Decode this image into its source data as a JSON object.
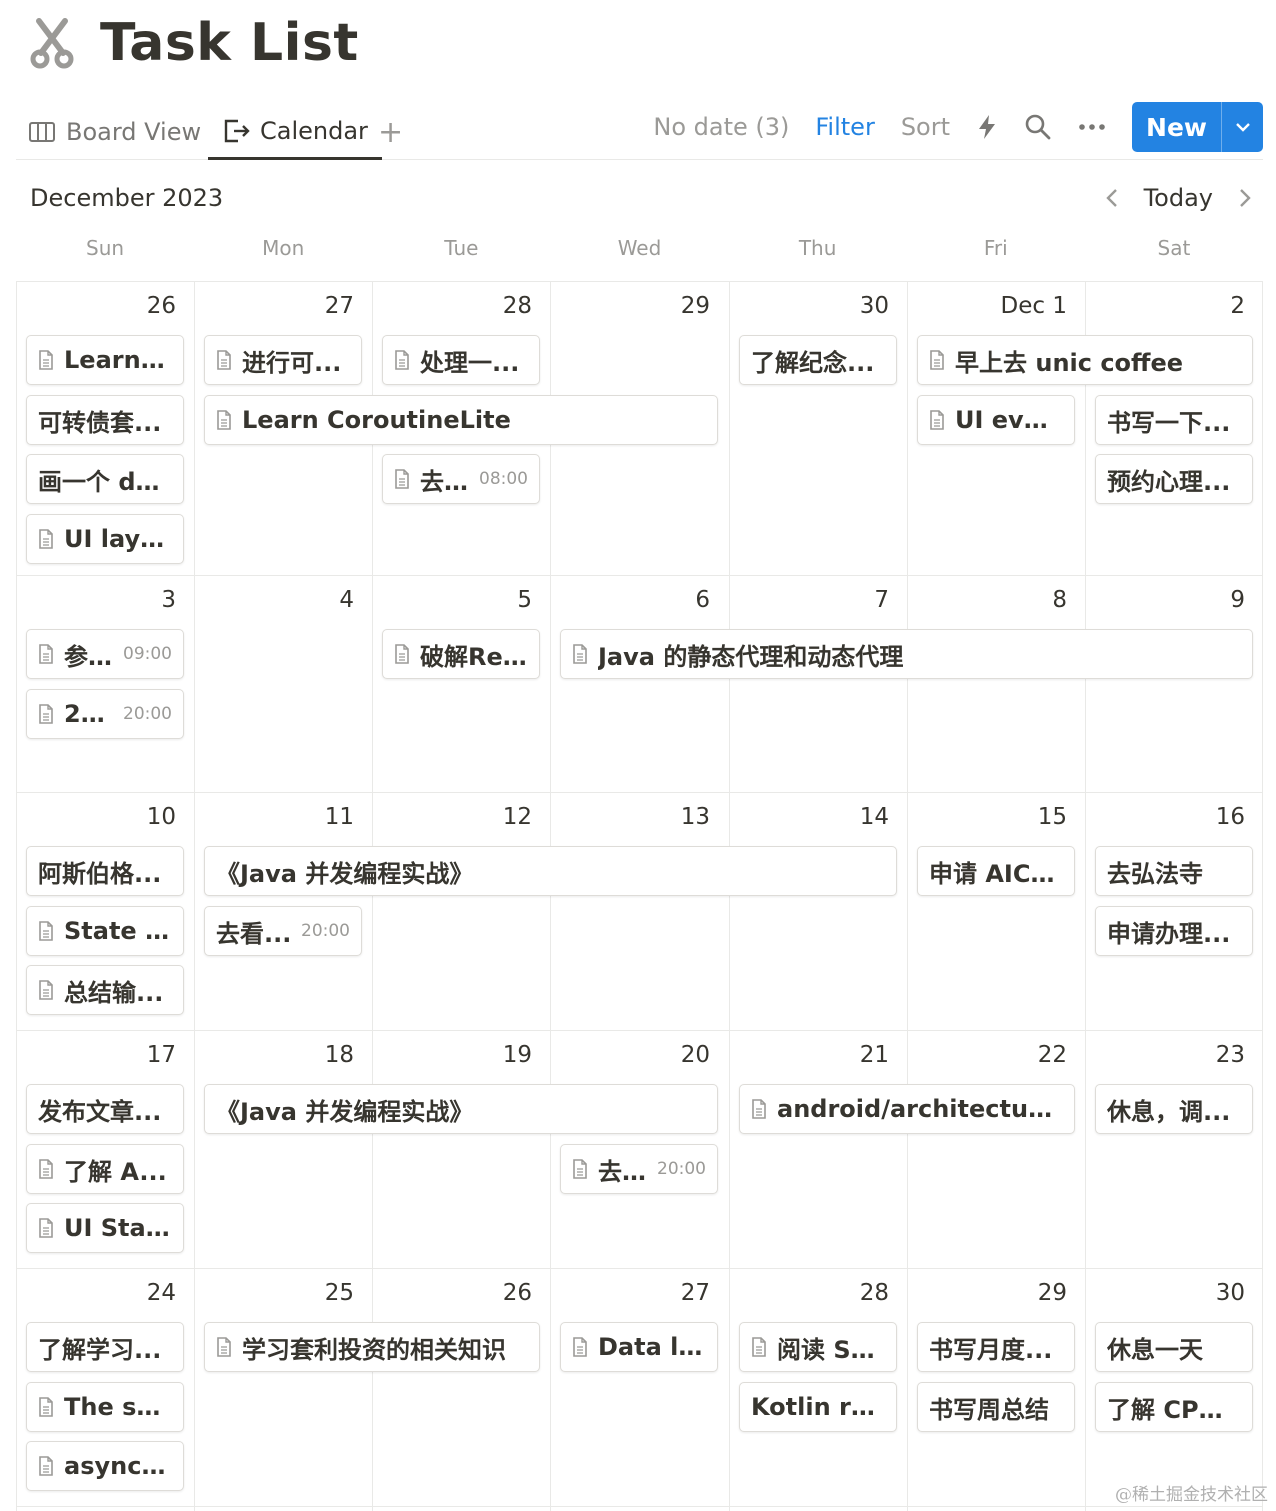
{
  "page": {
    "title": "Task List",
    "icon": "scissors-icon"
  },
  "tabs": {
    "board": "Board View",
    "calendar": "Calendar",
    "add": "+"
  },
  "toolbar": {
    "no_date": "No date (3)",
    "filter": "Filter",
    "sort": "Sort",
    "new": "New"
  },
  "calendar": {
    "month": "December 2023",
    "today": "Today",
    "weekdays": [
      "Sun",
      "Mon",
      "Tue",
      "Wed",
      "Thu",
      "Fri",
      "Sat"
    ],
    "weeks": [
      [
        "26",
        "27",
        "28",
        "29",
        "30",
        "Dec 1",
        "2"
      ],
      [
        "3",
        "4",
        "5",
        "6",
        "7",
        "8",
        "9"
      ],
      [
        "10",
        "11",
        "12",
        "13",
        "14",
        "15",
        "16"
      ],
      [
        "17",
        "18",
        "19",
        "20",
        "21",
        "22",
        "23"
      ],
      [
        "24",
        "25",
        "26",
        "27",
        "28",
        "29",
        "30"
      ]
    ],
    "events": [
      {
        "week": 0,
        "col": 0,
        "span": 1,
        "row": 0,
        "text": "Learn C...",
        "doc": true,
        "time": ""
      },
      {
        "week": 0,
        "col": 0,
        "span": 1,
        "row": 1,
        "text": "可转债套...",
        "doc": false,
        "time": ""
      },
      {
        "week": 0,
        "col": 0,
        "span": 1,
        "row": 2,
        "text": "画一个 dp...",
        "doc": false,
        "time": ""
      },
      {
        "week": 0,
        "col": 0,
        "span": 1,
        "row": 3,
        "text": "UI laye...",
        "doc": true,
        "time": ""
      },
      {
        "week": 0,
        "col": 1,
        "span": 1,
        "row": 0,
        "text": "进行可...",
        "doc": true,
        "time": ""
      },
      {
        "week": 0,
        "col": 1,
        "span": 3,
        "row": 1,
        "text": "Learn CoroutineLite",
        "doc": true,
        "time": ""
      },
      {
        "week": 0,
        "col": 2,
        "span": 1,
        "row": 0,
        "text": "处理一...",
        "doc": true,
        "time": ""
      },
      {
        "week": 0,
        "col": 2,
        "span": 1,
        "row": 2,
        "text": "去...",
        "doc": true,
        "time": "08:00"
      },
      {
        "week": 0,
        "col": 4,
        "span": 1,
        "row": 0,
        "text": "了解纪念...",
        "doc": false,
        "time": ""
      },
      {
        "week": 0,
        "col": 5,
        "span": 2,
        "row": 0,
        "text": "早上去 unic coffee",
        "doc": true,
        "time": ""
      },
      {
        "week": 0,
        "col": 5,
        "span": 1,
        "row": 1,
        "text": "UI even...",
        "doc": true,
        "time": ""
      },
      {
        "week": 0,
        "col": 6,
        "span": 1,
        "row": 1,
        "text": "书写一下...",
        "doc": false,
        "time": ""
      },
      {
        "week": 0,
        "col": 6,
        "span": 1,
        "row": 2,
        "text": "预约心理...",
        "doc": false,
        "time": ""
      },
      {
        "week": 1,
        "col": 0,
        "span": 1,
        "row": 0,
        "text": "参...",
        "doc": true,
        "time": "09:00"
      },
      {
        "week": 1,
        "col": 0,
        "span": 1,
        "row": 1,
        "text": "20...",
        "doc": true,
        "time": "20:00"
      },
      {
        "week": 1,
        "col": 2,
        "span": 1,
        "row": 0,
        "text": "破解Re...",
        "doc": true,
        "time": ""
      },
      {
        "week": 1,
        "col": 3,
        "span": 4,
        "row": 0,
        "text": "Java 的静态代理和动态代理",
        "doc": true,
        "time": ""
      },
      {
        "week": 2,
        "col": 0,
        "span": 1,
        "row": 0,
        "text": "阿斯伯格...",
        "doc": false,
        "time": ""
      },
      {
        "week": 2,
        "col": 0,
        "span": 1,
        "row": 1,
        "text": "State h...",
        "doc": true,
        "time": ""
      },
      {
        "week": 2,
        "col": 0,
        "span": 1,
        "row": 2,
        "text": "总结输...",
        "doc": true,
        "time": ""
      },
      {
        "week": 2,
        "col": 1,
        "span": 4,
        "row": 0,
        "text": "《Java 并发编程实战》",
        "doc": false,
        "time": ""
      },
      {
        "week": 2,
        "col": 1,
        "span": 1,
        "row": 1,
        "text": "去看...",
        "doc": false,
        "time": "20:00"
      },
      {
        "week": 2,
        "col": 5,
        "span": 1,
        "row": 0,
        "text": "申请 AICo...",
        "doc": false,
        "time": ""
      },
      {
        "week": 2,
        "col": 6,
        "span": 1,
        "row": 0,
        "text": "去弘法寺",
        "doc": false,
        "time": ""
      },
      {
        "week": 2,
        "col": 6,
        "span": 1,
        "row": 1,
        "text": "申请办理...",
        "doc": false,
        "time": ""
      },
      {
        "week": 3,
        "col": 0,
        "span": 1,
        "row": 0,
        "text": "发布文章...",
        "doc": false,
        "time": ""
      },
      {
        "week": 3,
        "col": 0,
        "span": 1,
        "row": 1,
        "text": "了解 A...",
        "doc": true,
        "time": ""
      },
      {
        "week": 3,
        "col": 0,
        "span": 1,
        "row": 2,
        "text": "UI Stat...",
        "doc": true,
        "time": ""
      },
      {
        "week": 3,
        "col": 1,
        "span": 3,
        "row": 0,
        "text": "《Java 并发编程实战》",
        "doc": false,
        "time": ""
      },
      {
        "week": 3,
        "col": 3,
        "span": 1,
        "row": 1,
        "text": "去...",
        "doc": true,
        "time": "20:00"
      },
      {
        "week": 3,
        "col": 4,
        "span": 2,
        "row": 0,
        "text": "android/architecture-sa...",
        "doc": true,
        "time": ""
      },
      {
        "week": 3,
        "col": 6,
        "span": 1,
        "row": 0,
        "text": "休息，调...",
        "doc": false,
        "time": ""
      },
      {
        "week": 4,
        "col": 0,
        "span": 1,
        "row": 0,
        "text": "了解学习...",
        "doc": false,
        "time": ""
      },
      {
        "week": 4,
        "col": 0,
        "span": 1,
        "row": 1,
        "text": "The sus...",
        "doc": true,
        "time": ""
      },
      {
        "week": 4,
        "col": 0,
        "span": 1,
        "row": 2,
        "text": "async a...",
        "doc": true,
        "time": ""
      },
      {
        "week": 4,
        "col": 1,
        "span": 2,
        "row": 0,
        "text": "学习套利投资的相关知识",
        "doc": true,
        "time": ""
      },
      {
        "week": 4,
        "col": 3,
        "span": 1,
        "row": 0,
        "text": "Data la...",
        "doc": true,
        "time": ""
      },
      {
        "week": 4,
        "col": 4,
        "span": 1,
        "row": 0,
        "text": "阅读 Sk...",
        "doc": true,
        "time": ""
      },
      {
        "week": 4,
        "col": 4,
        "span": 1,
        "row": 1,
        "text": "Kotlin reifi...",
        "doc": false,
        "time": ""
      },
      {
        "week": 4,
        "col": 5,
        "span": 1,
        "row": 0,
        "text": "书写月度...",
        "doc": false,
        "time": ""
      },
      {
        "week": 4,
        "col": 5,
        "span": 1,
        "row": 1,
        "text": "书写周总结",
        "doc": false,
        "time": ""
      },
      {
        "week": 4,
        "col": 6,
        "span": 1,
        "row": 0,
        "text": "休息一天",
        "doc": false,
        "time": ""
      },
      {
        "week": 4,
        "col": 6,
        "span": 1,
        "row": 1,
        "text": "了解 CPU ...",
        "doc": false,
        "time": ""
      }
    ]
  },
  "watermark": "@稀土掘金技术社区"
}
